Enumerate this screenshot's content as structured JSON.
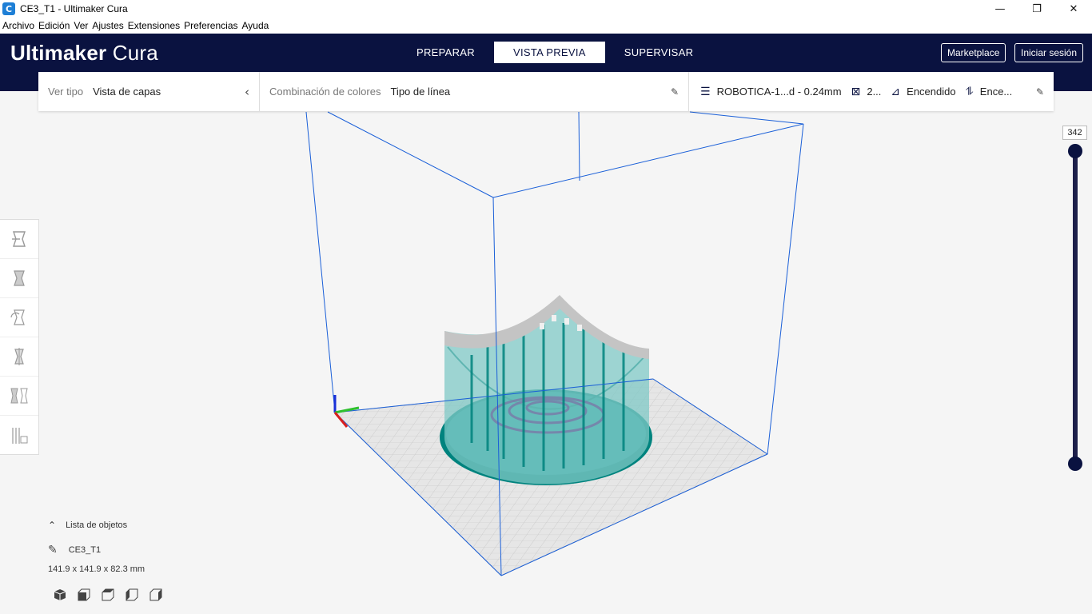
{
  "window": {
    "title": "CE3_T1 - Ultimaker Cura",
    "app_icon_letter": "C",
    "controls": {
      "minimize": "—",
      "restore": "❐",
      "close": "✕"
    }
  },
  "menu": [
    "Archivo",
    "Edición",
    "Ver",
    "Ajustes",
    "Extensiones",
    "Preferencias",
    "Ayuda"
  ],
  "header": {
    "logo_bold": "Ultimaker",
    "logo_light": "Cura",
    "tabs": [
      {
        "label": "PREPARAR",
        "active": false
      },
      {
        "label": "VISTA PREVIA",
        "active": true
      },
      {
        "label": "SUPERVISAR",
        "active": false
      }
    ],
    "marketplace": "Marketplace",
    "signin": "Iniciar sesión"
  },
  "toolbar": {
    "view_type_label": "Ver tipo",
    "view_type_value": "Vista de capas",
    "color_scheme_label": "Combinación de colores",
    "color_scheme_value": "Tipo de línea",
    "profile": "ROBOTICA-1...d - 0.24mm",
    "infill": "2...",
    "support": "Encendido",
    "adhesion": "Ence..."
  },
  "layer_slider": {
    "value": "342",
    "max_fraction": 1.0,
    "min_fraction": 0.0
  },
  "object_list": {
    "header": "Lista de objetos",
    "object_name": "CE3_T1",
    "dimensions": "141.9 x 141.9 x 82.3 mm"
  },
  "colors": {
    "header_bg": "#0a1240",
    "model_wall": "#00837e",
    "model_shell": "#7fc8c5",
    "support": "#bcbcbc",
    "build_volume": "#1a5fd8",
    "plate": "#dcdcdc"
  }
}
